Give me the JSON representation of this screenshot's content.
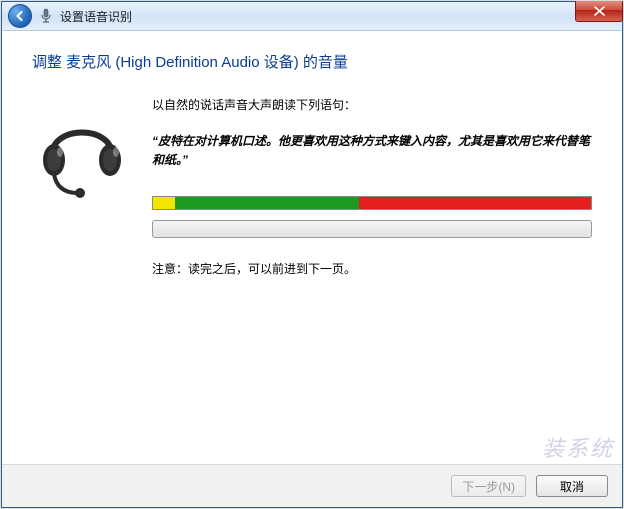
{
  "titlebar": {
    "title": "设置语音识别"
  },
  "heading": "调整 麦克风 (High Definition Audio 设备) 的音量",
  "instructions": "以自然的说话声音大声朗读下列语句：",
  "quote": "“皮特在对计算机口述。他更喜欢用这种方式来键入内容，尤其是喜欢用它来代替笔和纸。”",
  "note": "注意：读完之后，可以前进到下一页。",
  "meter": {
    "yellow_pct": 5,
    "green_pct": 42,
    "red_pct": 53
  },
  "footer": {
    "next_label": "下一步(N)",
    "cancel_label": "取消"
  },
  "watermark": "装系统"
}
